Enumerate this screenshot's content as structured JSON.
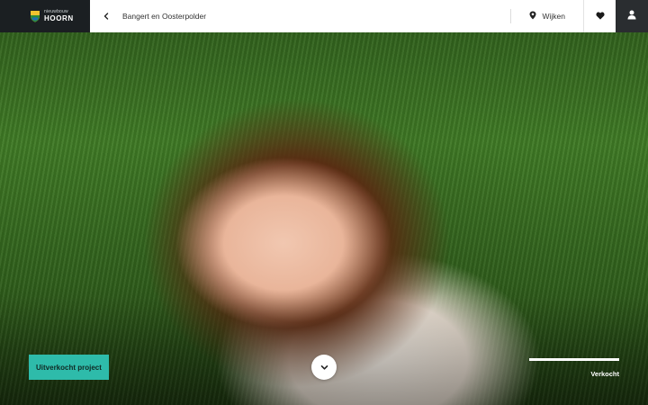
{
  "brand": {
    "name_small": "nieuwbouw",
    "name_big": "HOORN",
    "accent_green": "#2e8b3a",
    "accent_blue": "#1f6fb5"
  },
  "nav": {
    "breadcrumb": "Bangert en Oosterpolder",
    "wijken_label": "Wijken",
    "back_icon": "chevron-left-icon",
    "wijken_icon": "map-pin-icon",
    "favorite_icon": "heart-icon",
    "user_icon": "user-icon"
  },
  "hero": {
    "badge_label": "Uitverkocht project",
    "badge_color": "#2ebbaa",
    "scroll_icon": "chevron-down-icon",
    "status_label": "Verkocht",
    "progress": 1.0
  }
}
